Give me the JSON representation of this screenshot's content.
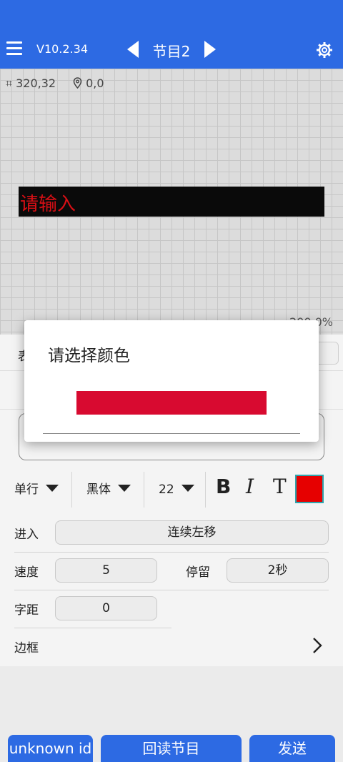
{
  "header": {
    "version": "V10.2.34",
    "program_title": "节目2"
  },
  "canvas": {
    "coords": "320,32",
    "location": "0,0",
    "zoom": "200.0%",
    "preview_text": "请输入",
    "preview_text_color": "#d80f15",
    "preview_bg": "#0a0a0a"
  },
  "panel": {
    "partial_label": "表"
  },
  "format": {
    "line_mode": "单行",
    "font": "黑体",
    "size": "22",
    "bold_label": "B",
    "italic_label": "I",
    "text_label": "T",
    "text_color": "#e60000"
  },
  "fields": {
    "enter_label": "进入",
    "enter_value": "连续左移",
    "speed_label": "速度",
    "speed_value": "5",
    "stay_label": "停留",
    "stay_value": "2秒",
    "spacing_label": "字距",
    "spacing_value": "0",
    "border_label": "边框"
  },
  "buttons": {
    "left": "unknown id",
    "readback": "回读节目",
    "send": "发送"
  },
  "dialog": {
    "title": "请选择颜色",
    "selected_color": "#d80a30"
  }
}
